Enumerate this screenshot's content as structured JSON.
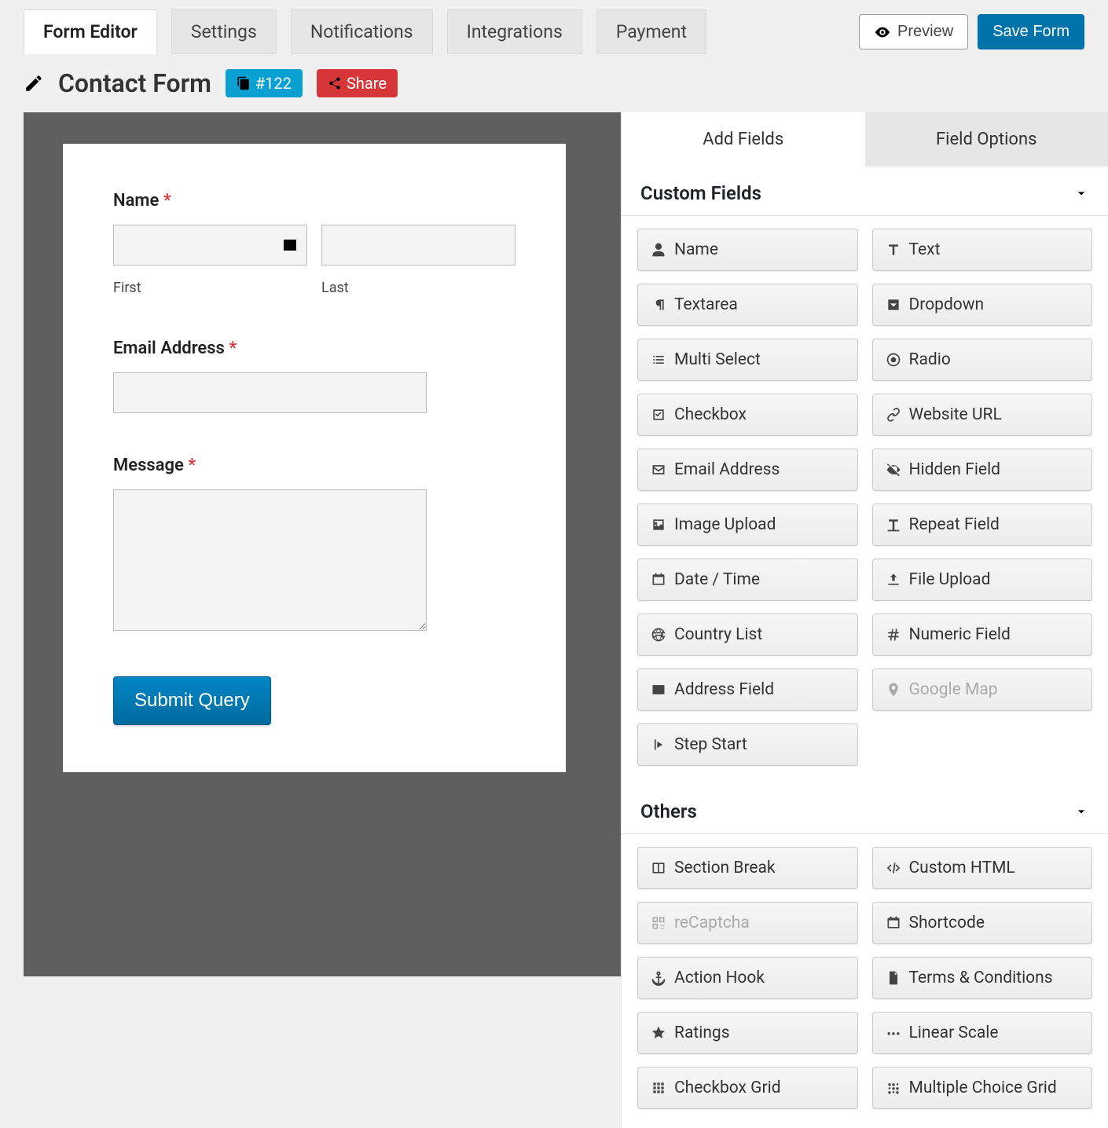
{
  "tabs": {
    "form_editor": "Form Editor",
    "settings": "Settings",
    "notifications": "Notifications",
    "integrations": "Integrations",
    "payment": "Payment"
  },
  "actions": {
    "preview": "Preview",
    "save": "Save Form"
  },
  "form": {
    "title": "Contact Form",
    "id_badge": "#122",
    "share": "Share"
  },
  "preview_form": {
    "name_label": "Name",
    "first": "First",
    "last": "Last",
    "email_label": "Email Address",
    "message_label": "Message",
    "submit": "Submit Query"
  },
  "sidebar": {
    "tabs": {
      "add": "Add Fields",
      "options": "Field Options"
    },
    "sections": {
      "custom": "Custom Fields",
      "others": "Others"
    },
    "custom_fields": [
      {
        "label": "Name",
        "icon": "user"
      },
      {
        "label": "Text",
        "icon": "text"
      },
      {
        "label": "Textarea",
        "icon": "paragraph"
      },
      {
        "label": "Dropdown",
        "icon": "caret-square"
      },
      {
        "label": "Multi Select",
        "icon": "list"
      },
      {
        "label": "Radio",
        "icon": "radio"
      },
      {
        "label": "Checkbox",
        "icon": "check-square"
      },
      {
        "label": "Website URL",
        "icon": "link"
      },
      {
        "label": "Email Address",
        "icon": "envelope"
      },
      {
        "label": "Hidden Field",
        "icon": "eye-slash"
      },
      {
        "label": "Image Upload",
        "icon": "image"
      },
      {
        "label": "Repeat Field",
        "icon": "repeat-text"
      },
      {
        "label": "Date / Time",
        "icon": "calendar"
      },
      {
        "label": "File Upload",
        "icon": "upload"
      },
      {
        "label": "Country List",
        "icon": "globe"
      },
      {
        "label": "Numeric Field",
        "icon": "hash"
      },
      {
        "label": "Address Field",
        "icon": "address-card"
      },
      {
        "label": "Google Map",
        "icon": "map-marker",
        "disabled": true
      },
      {
        "label": "Step Start",
        "icon": "step"
      }
    ],
    "other_fields": [
      {
        "label": "Section Break",
        "icon": "columns"
      },
      {
        "label": "Custom HTML",
        "icon": "code"
      },
      {
        "label": "reCaptcha",
        "icon": "qrcode",
        "disabled": true
      },
      {
        "label": "Shortcode",
        "icon": "calendar2"
      },
      {
        "label": "Action Hook",
        "icon": "anchor"
      },
      {
        "label": "Terms & Conditions",
        "icon": "file"
      },
      {
        "label": "Ratings",
        "icon": "star"
      },
      {
        "label": "Linear Scale",
        "icon": "dots"
      },
      {
        "label": "Checkbox Grid",
        "icon": "grid"
      },
      {
        "label": "Multiple Choice Grid",
        "icon": "braille"
      }
    ]
  }
}
